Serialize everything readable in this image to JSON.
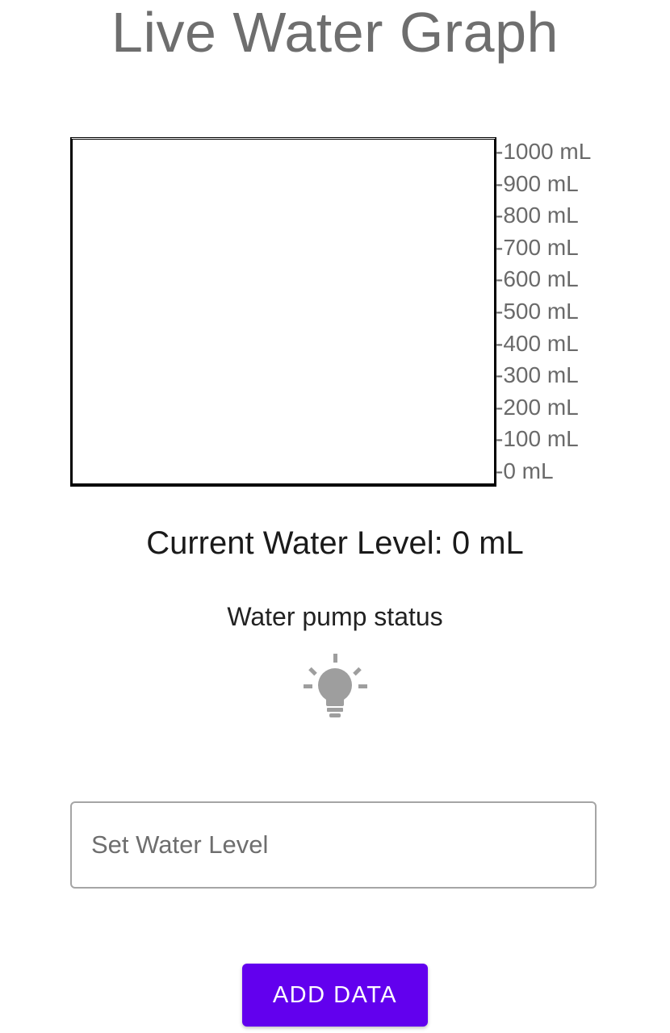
{
  "header": {
    "title": "Live Water Graph"
  },
  "graph": {
    "water_level_fraction": 0,
    "fill_color": "#4fa3e0",
    "scale_labels": [
      "-1000 mL",
      "-900 mL",
      "-800 mL",
      "-700 mL",
      "-600 mL",
      "-500 mL",
      "-400 mL",
      "-300 mL",
      "-200 mL",
      "-100 mL",
      "-0 mL"
    ]
  },
  "status": {
    "current_level_text": "Current Water Level: 0 mL",
    "pump_label": "Water pump status",
    "pump_icon": "lightbulb-icon",
    "pump_on": false,
    "pump_off_color": "#9e9e9e"
  },
  "form": {
    "input_placeholder": "Set Water Level",
    "input_value": "",
    "button_label": "ADD DATA",
    "button_color": "#6200ee"
  }
}
